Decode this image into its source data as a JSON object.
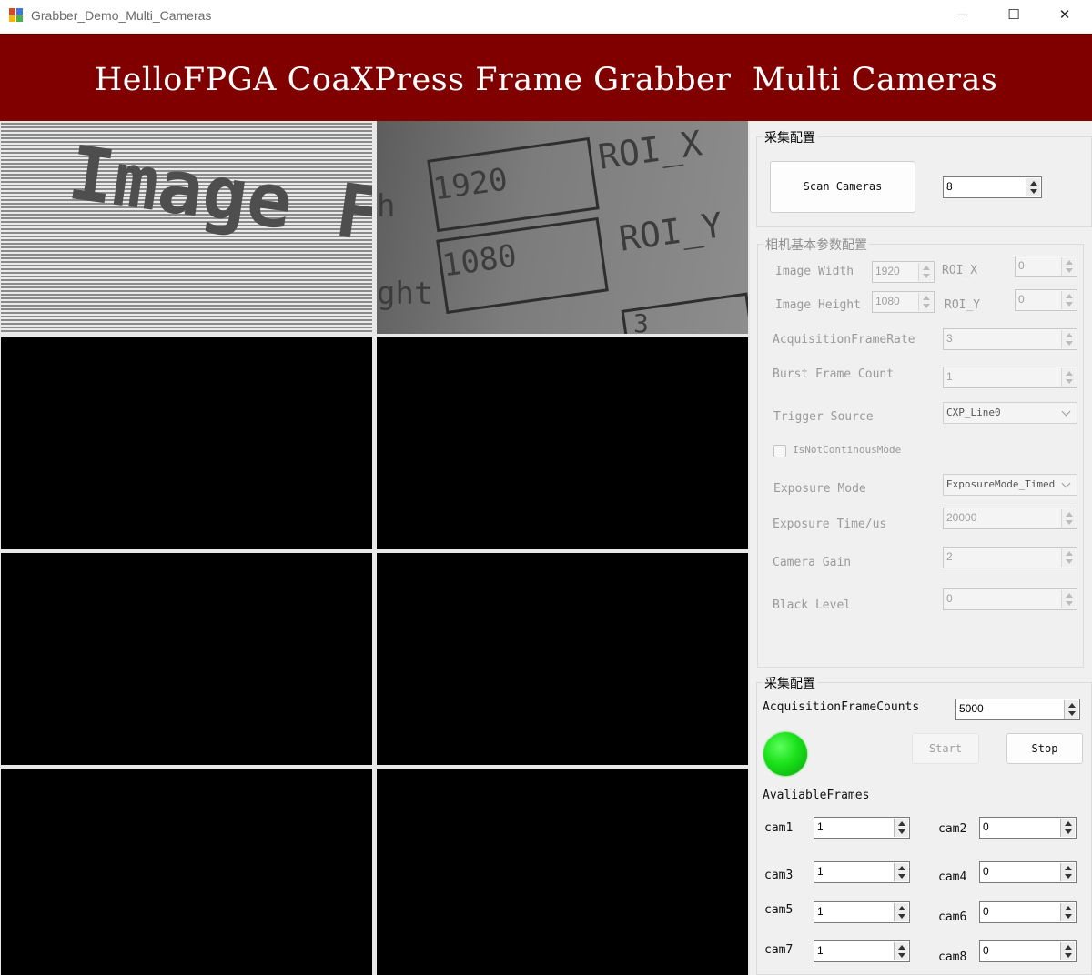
{
  "window": {
    "title": "Grabber_Demo_Multi_Cameras",
    "controls": {
      "minimize": "─",
      "maximize": "☐",
      "close": "✕"
    }
  },
  "banner": {
    "title": "HelloFPGA CoaXPress Frame Grabber  Multi Cameras"
  },
  "camera_view": {
    "cam1_text": "Image F",
    "cam2_fields": {
      "width_label": "h",
      "height_label": "ght",
      "width": "1920",
      "height": "1080",
      "roi_x": "ROI_X",
      "roi_y": "ROI_Y",
      "rate": "3"
    }
  },
  "scan_group": {
    "title": "采集配置",
    "scan_button": "Scan Cameras",
    "camera_count": "8"
  },
  "camera_params": {
    "title": "相机基本参数配置",
    "image_width_label": "Image Width",
    "image_width": "1920",
    "roi_x_label": "ROI_X",
    "roi_x": "0",
    "image_height_label": "Image Height",
    "image_height": "1080",
    "roi_y_label": "ROI_Y",
    "roi_y": "0",
    "frame_rate_label": "AcquisitionFrameRate",
    "frame_rate": "3",
    "burst_label": "Burst Frame Count",
    "burst": "1",
    "trigger_label": "Trigger Source",
    "trigger": "CXP_Line0",
    "continuous_label": "IsNotContinousMode",
    "exposure_mode_label": "Exposure Mode",
    "exposure_mode": "ExposureMode_Timed",
    "exposure_time_label": "Exposure Time/us",
    "exposure_time": "20000",
    "gain_label": "Camera Gain",
    "gain": "2",
    "black_level_label": "Black Level",
    "black_level": "0"
  },
  "acquisition": {
    "title": "采集配置",
    "frame_counts_label": "AcquisitionFrameCounts",
    "frame_counts": "5000",
    "start_button": "Start",
    "stop_button": "Stop",
    "status_color": "#1ad61a",
    "available_label": "AvaliableFrames",
    "cams": [
      {
        "label": "cam1",
        "value": "1"
      },
      {
        "label": "cam2",
        "value": "0"
      },
      {
        "label": "cam3",
        "value": "1"
      },
      {
        "label": "cam4",
        "value": "0"
      },
      {
        "label": "cam5",
        "value": "1"
      },
      {
        "label": "cam6",
        "value": "0"
      },
      {
        "label": "cam7",
        "value": "1"
      },
      {
        "label": "cam8",
        "value": "0"
      }
    ]
  },
  "colors": {
    "banner": "#800000",
    "window_bg": "#f0f0f0"
  }
}
